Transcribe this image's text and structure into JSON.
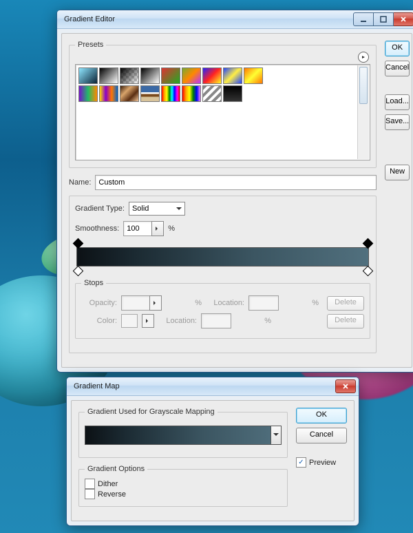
{
  "editor": {
    "title": "Gradient Editor",
    "buttons": {
      "ok": "OK",
      "cancel": "Cancel",
      "load": "Load...",
      "save": "Save...",
      "new": "New"
    },
    "presets_label": "Presets",
    "presets": [
      {
        "name": "foreground-to-background",
        "css": "linear-gradient(135deg,#8fe6ff,#0a2236)"
      },
      {
        "name": "black-white",
        "css": "linear-gradient(135deg,#000,#fff)"
      },
      {
        "name": "foreground-to-transparent",
        "css": "linear-gradient(135deg,#000,rgba(0,0,0,0)),repeating-conic-gradient(#ccc 0 25%,#fff 0 50%) 0/8px 8px"
      },
      {
        "name": "black-white-diagonal",
        "css": "linear-gradient(135deg,#000,#fff)"
      },
      {
        "name": "red-green",
        "css": "linear-gradient(135deg,#d33,#2a2)"
      },
      {
        "name": "violet-orange",
        "css": "linear-gradient(135deg,#7a3,#f80,#b3f)"
      },
      {
        "name": "blue-red-yellow",
        "css": "linear-gradient(135deg,#22f,#f22,#ff2)"
      },
      {
        "name": "blue-yellow-blue",
        "css": "linear-gradient(135deg,#24f,#fe4,#24f)"
      },
      {
        "name": "orange-yellow-orange",
        "css": "linear-gradient(135deg,#f70,#ff3,#f70)"
      },
      {
        "name": "violet-green-orange",
        "css": "linear-gradient(90deg,#71c,#2b6,#f80)"
      },
      {
        "name": "yellow-violet-orange-blue",
        "css": "linear-gradient(90deg,#fd0,#80c,#f70,#06c)"
      },
      {
        "name": "copper",
        "css": "linear-gradient(135deg,#3a1f0c,#d9a46b,#5a2e12,#f1c79a)"
      },
      {
        "name": "chrome",
        "css": "linear-gradient(180deg,#3a69a6 0 40%,#fff 40% 52%,#7a4a1c 52% 70%,#d8c39a 70%)"
      },
      {
        "name": "spectrum",
        "css": "linear-gradient(90deg,red,orange,yellow,green,cyan,blue,magenta,red)"
      },
      {
        "name": "transparent-rainbow",
        "css": "linear-gradient(90deg,red,orange,yellow,green,blue,violet)"
      },
      {
        "name": "transparent-stripes",
        "css": "repeating-linear-gradient(135deg,#888 0 4px,#fff 4px 8px)"
      },
      {
        "name": "neutral-density",
        "css": "linear-gradient(180deg,#000,#333)"
      }
    ],
    "name_label": "Name:",
    "name_value": "Custom",
    "gradient_type_label": "Gradient Type:",
    "gradient_type_value": "Solid",
    "smoothness_label": "Smoothness:",
    "smoothness_value": "100",
    "percent": "%",
    "gradient_css": "linear-gradient(90deg,#0c1115 0%, #1b2a32 20%, #3b5561 60%, #51707e 100%)",
    "stops": {
      "legend": "Stops",
      "opacity_label": "Opacity:",
      "color_label": "Color:",
      "location_label": "Location:",
      "delete_label": "Delete"
    }
  },
  "map": {
    "title": "Gradient Map",
    "section_label": "Gradient Used for Grayscale Mapping",
    "options_label": "Gradient Options",
    "dither_label": "Dither",
    "reverse_label": "Reverse",
    "dither_checked": false,
    "reverse_checked": false,
    "ok": "OK",
    "cancel": "Cancel",
    "preview_label": "Preview",
    "preview_checked": true,
    "gradient_css": "linear-gradient(90deg,#0c1115 0%, #1b2a32 20%, #3b5561 60%, #51707e 100%)"
  }
}
